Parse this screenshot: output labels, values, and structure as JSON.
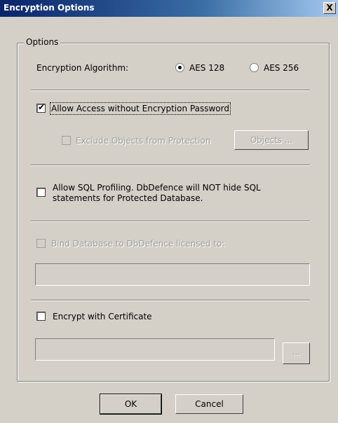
{
  "window": {
    "title": "Encryption Options",
    "close_glyph": "X"
  },
  "group": {
    "title": "Options"
  },
  "algorithm": {
    "label": "Encryption Algorithm:",
    "options": [
      {
        "label": "AES 128",
        "selected": true
      },
      {
        "label": "AES 256",
        "selected": false
      }
    ]
  },
  "allow_access": {
    "label": "Allow Access without Encryption Password",
    "checked": true
  },
  "exclude_objects": {
    "label": "Exclude Objects from Protection",
    "checked": false,
    "enabled": false
  },
  "objects_button": {
    "label": "Objects ..."
  },
  "sql_profiling": {
    "line1": "Allow SQL Profiling. DbDefence will NOT hide SQL",
    "line2": "statements for Protected Database.",
    "checked": false
  },
  "bind_database": {
    "label": "Bind Database to DbDefence licensed to:",
    "checked": false,
    "enabled": false,
    "value": ""
  },
  "certificate": {
    "label": "Encrypt with Certificate",
    "checked": false,
    "value": "",
    "browse_label": "..."
  },
  "footer": {
    "ok_label": "OK",
    "cancel_label": "Cancel"
  },
  "check_glyph": "✔",
  "colors": {
    "dialog_bg": "#d4d0c8",
    "title_start": "#0a246a",
    "title_end": "#a6caf0"
  }
}
